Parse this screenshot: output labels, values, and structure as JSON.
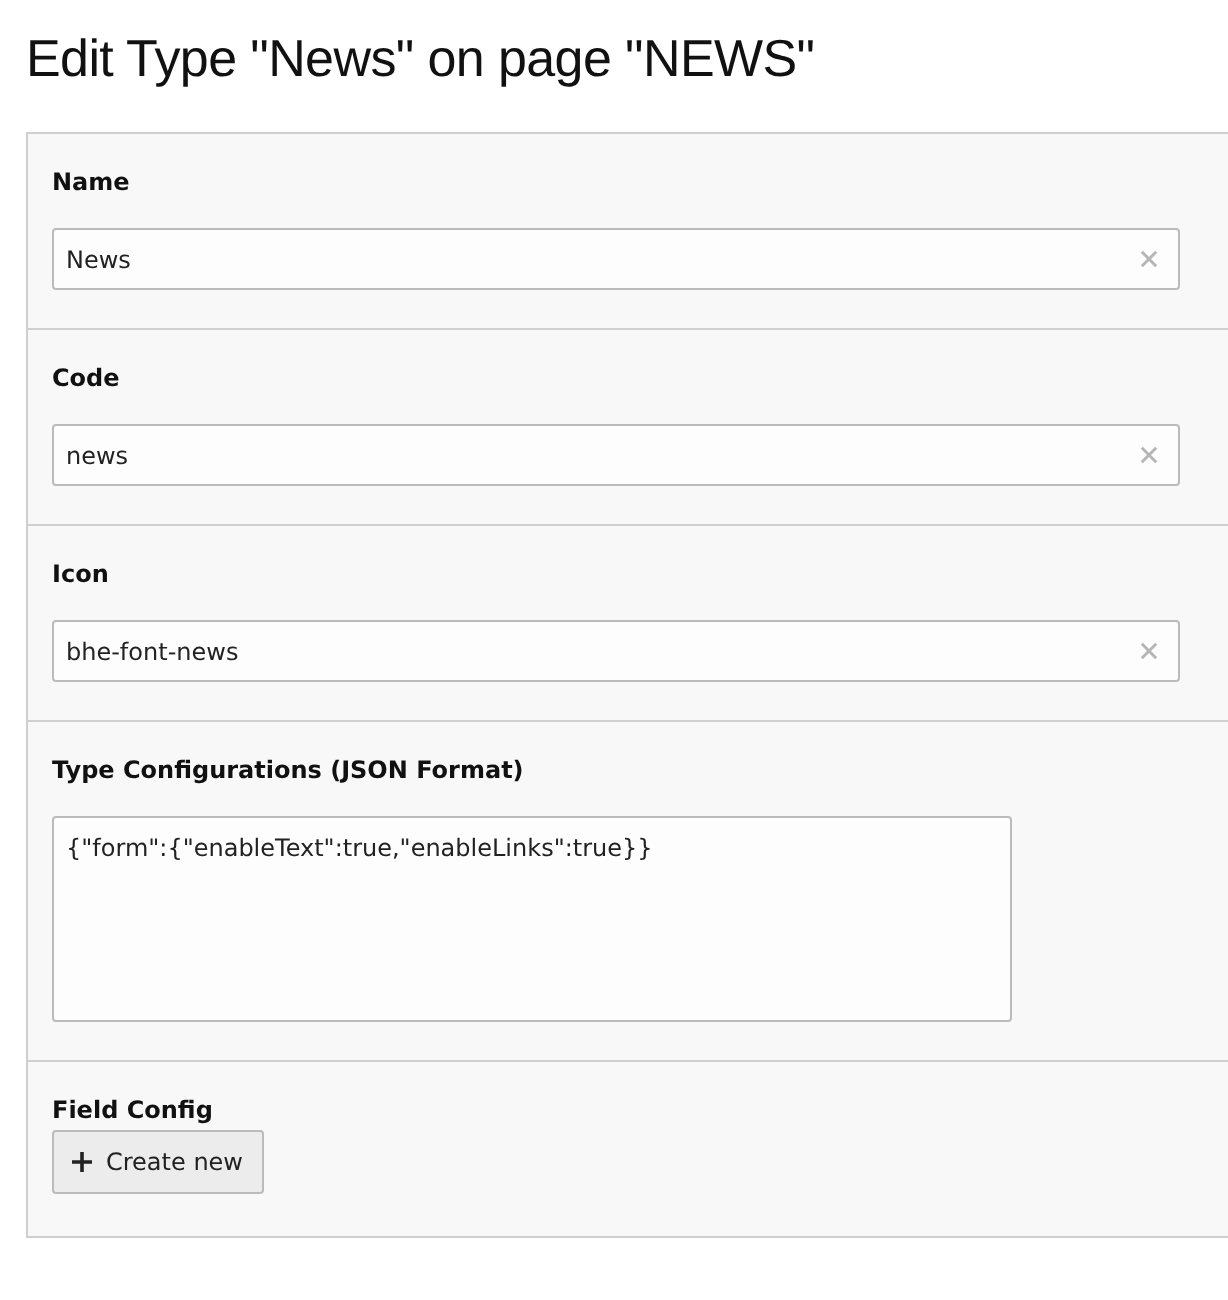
{
  "title": "Edit Type \"News\" on page \"NEWS\"",
  "sections": [
    {
      "kind": "input",
      "label": "Name",
      "value": "News"
    },
    {
      "kind": "input",
      "label": "Code",
      "value": "news"
    },
    {
      "kind": "input",
      "label": "Icon",
      "value": "bhe-font-news"
    },
    {
      "kind": "textarea",
      "label": "Type Configurations (JSON Format)",
      "value": "{\"form\":{\"enableText\":true,\"enableLinks\":true}}"
    },
    {
      "kind": "button",
      "label": "Field Config",
      "button": "Create new"
    }
  ]
}
